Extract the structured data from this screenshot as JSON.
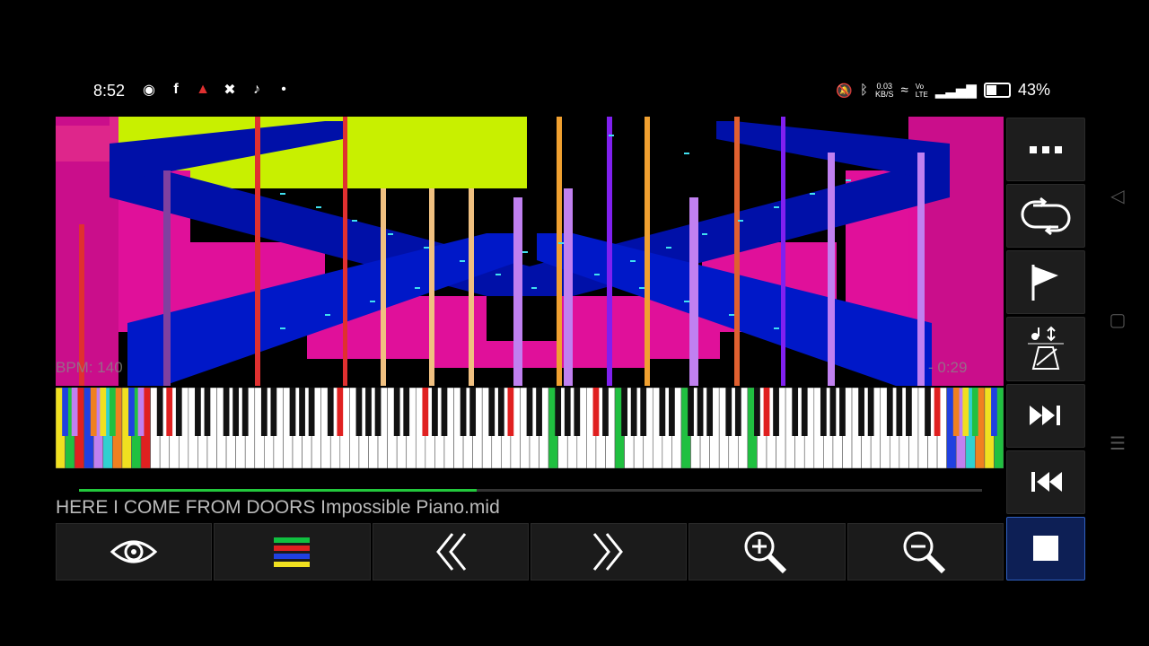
{
  "status_bar": {
    "time": "8:52",
    "left_icons": [
      "gmail-like-icon",
      "facebook-icon",
      "bird-icon",
      "missed-call-icon",
      "tiktok-icon",
      "dot-icon"
    ],
    "net_speed_value": "0.03",
    "net_speed_unit": "KB/S",
    "volte": "VoLTE",
    "battery_percent": "43%",
    "battery_level": 0.43
  },
  "player": {
    "bpm_label": "BPM: 140",
    "duration_label": "- 0:29",
    "file_name": "HERE I COME FROM DOORS Impossible Piano.mid",
    "progress": 0.44
  },
  "bottom_toolbar": {
    "buttons": [
      "eye-icon",
      "color-bars-icon",
      "chevron-left-icon",
      "chevron-right-icon",
      "zoom-in-icon",
      "zoom-out-icon"
    ]
  },
  "side_panel": {
    "buttons": [
      "more-dots-icon",
      "loop-icon",
      "flag-icon",
      "metronome-icon",
      "skip-forward-icon",
      "skip-back-icon",
      "stop-icon"
    ]
  },
  "colors": {
    "progress": "#22c83c",
    "magenta": "#e0109a",
    "lime": "#c8f000",
    "blue": "#0010a8",
    "stop_bg": "#0d1f55"
  }
}
